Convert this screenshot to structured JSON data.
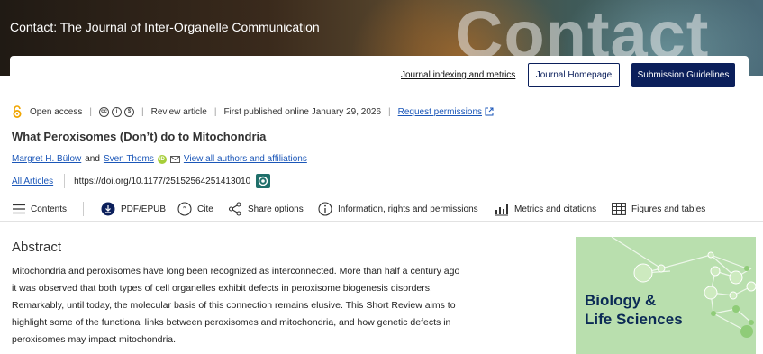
{
  "banner": {
    "title": "Contact: The Journal of Inter-Organelle Communication",
    "wordmark": "Contact"
  },
  "topnav": {
    "indexing_link": "Journal indexing and metrics",
    "homepage_button": "Journal Homepage",
    "guidelines_button": "Submission Guidelines"
  },
  "meta": {
    "access": "Open access",
    "license_icons": [
      "cc-icon",
      "by-icon",
      "nc-icon"
    ],
    "article_type": "Review article",
    "published": "First published online January 29, 2026",
    "permissions_link": "Request permissions"
  },
  "article": {
    "title": "What Peroxisomes (Don’t) do to Mitochondria",
    "author1": "Margret H. Bülow",
    "and_text": "and",
    "author2": "Sven Thoms",
    "view_all": "View all authors and affiliations",
    "all_articles": "All Articles",
    "doi": "https://doi.org/10.1177/25152564251413010"
  },
  "toolbar": {
    "contents": "Contents",
    "pdf": "PDF/EPUB",
    "cite": "Cite",
    "share": "Share options",
    "info": "Information, rights and permissions",
    "metrics": "Metrics and citations",
    "figures": "Figures and tables"
  },
  "abstract": {
    "heading": "Abstract",
    "lines": [
      "Mitochondria and peroxisomes have long been recognized as interconnected. More than half a century ago",
      "it was observed that both types of cell organelles exhibit defects in peroxisome biogenesis disorders.",
      "Remarkably, until today, the molecular basis of this connection remains elusive. This Short Review aims to",
      "highlight some of the functional links between peroxisomes and mitochondria, and how genetic defects in",
      "peroxisomes may impact mitochondria."
    ]
  },
  "ad": {
    "line1": "Biology &",
    "line2": "Life Sciences",
    "background": "#b9dfae"
  },
  "colors": {
    "navy": "#0b1f5b",
    "link": "#1a56b8",
    "open_access": "#f0a500"
  }
}
